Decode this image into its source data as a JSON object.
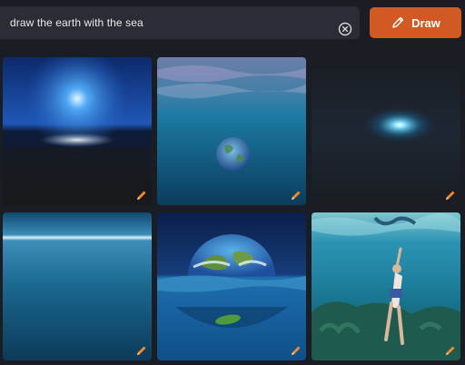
{
  "search": {
    "value": "draw the earth with the sea"
  },
  "actions": {
    "draw_label": "Draw",
    "draw_icon": "pencil-icon",
    "clear_icon": "clear-circle-icon"
  },
  "colors": {
    "accent": "#d15a24",
    "background": "#1a1d24",
    "input_bg": "#2a2d35"
  },
  "results": [
    {
      "id": "result-1",
      "icon": "pencil-icon"
    },
    {
      "id": "result-2",
      "icon": "pencil-icon"
    },
    {
      "id": "result-3",
      "icon": "pencil-icon"
    },
    {
      "id": "result-4",
      "icon": "pencil-icon"
    },
    {
      "id": "result-5",
      "icon": "pencil-icon"
    },
    {
      "id": "result-6",
      "icon": "pencil-icon"
    }
  ]
}
